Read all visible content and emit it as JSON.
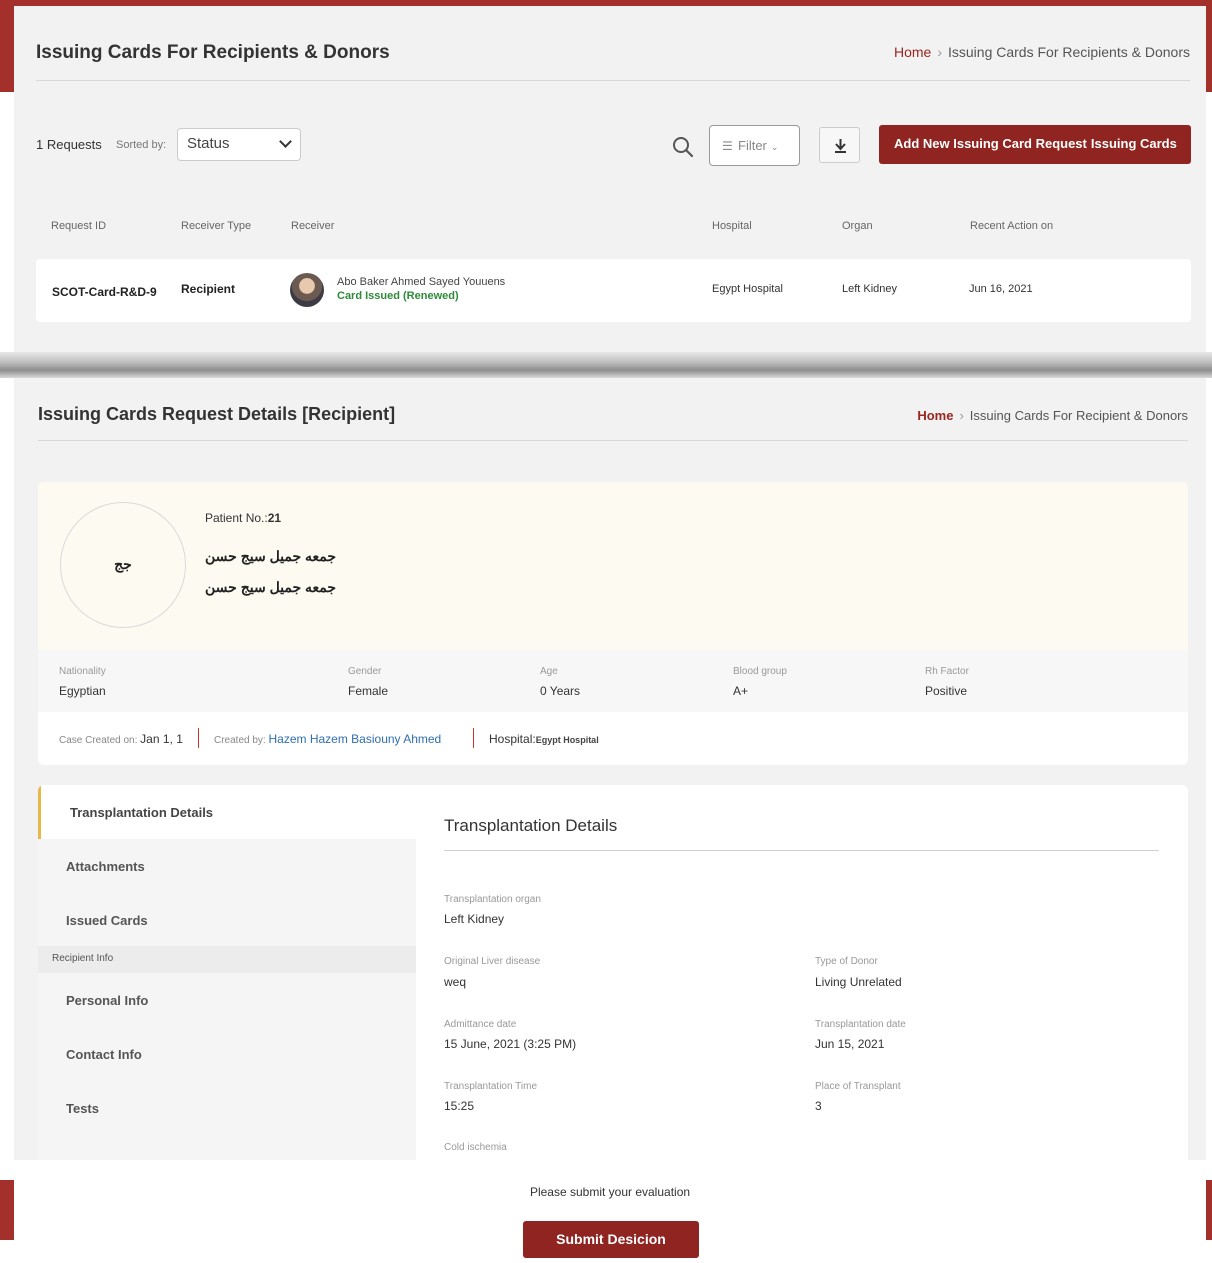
{
  "list_page": {
    "title": "Issuing Cards For Recipients & Donors",
    "breadcrumb": {
      "home": "Home",
      "current": "Issuing Cards For Recipients & Donors"
    },
    "request_count": "1 Requests",
    "sorted_by_label": "Sorted by:",
    "sort_value": "Status",
    "filter_label": "Filter",
    "add_button": "Add New Issuing Card Request",
    "add_button_suffix": "Issuing Cards",
    "columns": [
      "Request ID",
      "Receiver Type",
      "Receiver",
      "Hospital",
      "Organ",
      "Recent Action on"
    ],
    "rows": [
      {
        "request_id": "SCOT-Card-R&D-9",
        "receiver_type": "Recipient",
        "receiver_name": "Abo Baker Ahmed Sayed Youuens",
        "receiver_status": "Card Issued (Renewed)",
        "hospital": "Egypt Hospital",
        "organ": "Left Kidney",
        "recent_action": "Jun 16, 2021"
      }
    ]
  },
  "details_page": {
    "title": "Issuing Cards Request Details [Recipient]",
    "breadcrumb": {
      "home": "Home",
      "current": "Issuing Cards For Recipient & Donors"
    },
    "patient": {
      "initials": "جج",
      "number_label": "Patient No.:",
      "number": "21",
      "name_line1": "جمعه جميل سيج حسن",
      "name_line2": "جمعه جميل سيج حسن"
    },
    "info": [
      {
        "label": "Nationality",
        "value": "Egyptian"
      },
      {
        "label": "Gender",
        "value": "Female"
      },
      {
        "label": "Age",
        "value": "0 Years"
      },
      {
        "label": "Blood group",
        "value": "A+"
      },
      {
        "label": "Rh Factor",
        "value": "Positive"
      }
    ],
    "meta": {
      "created_on_label": "Case Created on:",
      "created_on": "Jan 1, 1",
      "created_by_label": "Created by:",
      "created_by": "Hazem Hazem Basiouny Ahmed",
      "hospital_label": "Hospital:",
      "hospital": "Egypt Hospital"
    },
    "sidebar": {
      "items": [
        "Transplantation Details",
        "Attachments",
        "Issued Cards"
      ],
      "section": "Recipient Info",
      "section_items": [
        "Personal Info",
        "Contact Info",
        "Tests"
      ]
    },
    "transplantation": {
      "title": "Transplantation Details",
      "fields": {
        "organ": {
          "label": "Transplantation organ",
          "value": "Left Kidney"
        },
        "liver_disease": {
          "label": "Original Liver disease",
          "value": "weq"
        },
        "donor_type": {
          "label": "Type of Donor",
          "value": "Living Unrelated"
        },
        "admittance_date": {
          "label": "Admittance date",
          "value": "15 June, 2021 (3:25 PM)"
        },
        "transplant_date": {
          "label": "Transplantation date",
          "value": "Jun 15, 2021"
        },
        "transplant_time": {
          "label": "Transplantation Time",
          "value": "15:25"
        },
        "place": {
          "label": "Place of Transplant",
          "value": "3"
        },
        "cold_ischemia": {
          "label": "Cold ischemia"
        }
      }
    }
  },
  "footer": {
    "prompt": "Please submit your evaluation",
    "submit": "Submit Desicion"
  },
  "colors": {
    "brand_red": "#8f2420",
    "accent": "#e8b84a",
    "success": "#2e8b3a",
    "link": "#2f6fb0"
  }
}
